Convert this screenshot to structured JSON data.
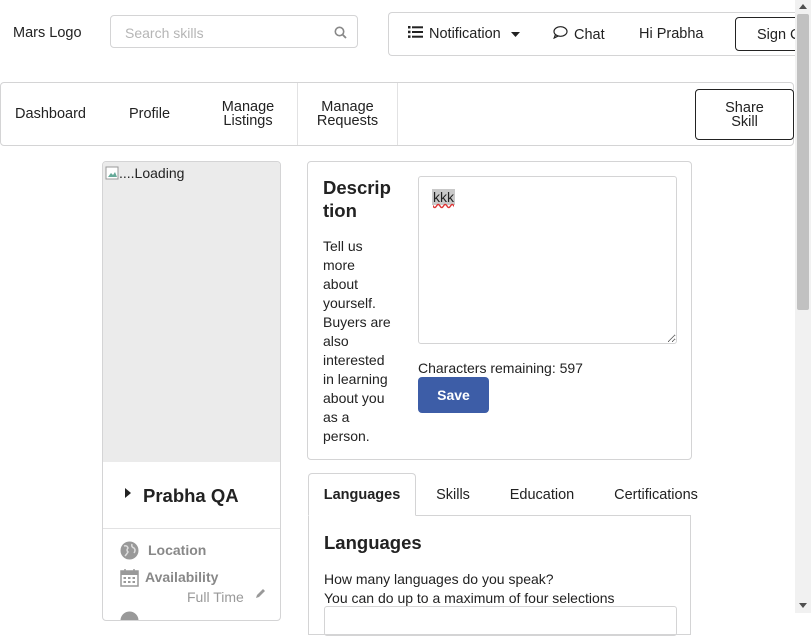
{
  "header": {
    "logo": "Mars Logo",
    "search_placeholder": "Search skills",
    "notification": "Notification",
    "chat": "Chat",
    "greeting": "Hi Prabha",
    "sign_out": "Sign C"
  },
  "nav": {
    "items": [
      "Dashboard",
      "Profile",
      "Manage Listings",
      "Manage Requests"
    ],
    "share_skill": "Share Skill"
  },
  "profile": {
    "image_alt": "....Loading",
    "name": "Prabha QA",
    "location_label": "Location",
    "availability_label": "Availability",
    "availability_value": "Full Time"
  },
  "description": {
    "title": "Description",
    "help": "Tell us more about yourself. Buyers are also interested in learning about you as a person.",
    "value": "kkk",
    "chars_remaining": "Characters remaining: 597",
    "save_label": "Save"
  },
  "tabs": {
    "items": [
      "Languages",
      "Skills",
      "Education",
      "Certifications"
    ],
    "active": "Languages"
  },
  "languages": {
    "heading": "Languages",
    "question": "How many languages do you speak?",
    "hint": "You can do up to a maximum of four selections"
  },
  "colors": {
    "primary_button": "#3d5da7",
    "border": "#d4d4d5"
  }
}
